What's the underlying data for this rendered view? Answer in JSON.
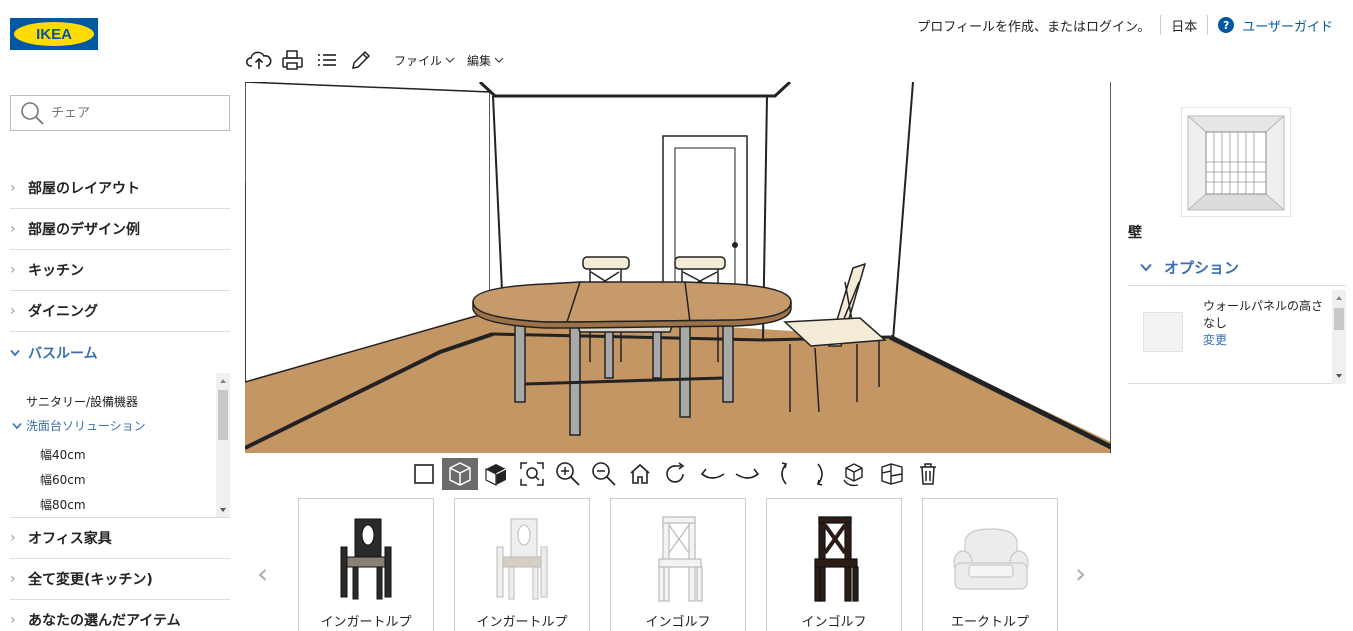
{
  "brand": {
    "logo_text": "IKEA",
    "logo_bg": "#0058a3",
    "logo_fg": "#ffdb00"
  },
  "header": {
    "login_text": "プロフィールを作成、またはログイン。",
    "language": "日本",
    "guide_label": "ユーザーガイド",
    "guide_icon": "?"
  },
  "toolbar": {
    "icons": [
      "cloud-save-icon",
      "print-icon",
      "list-icon",
      "pencil-icon"
    ],
    "file_menu": "ファイル",
    "edit_menu": "編集"
  },
  "sidebar": {
    "search": {
      "value": "",
      "placeholder": "チェア"
    },
    "categories": [
      {
        "label": "部屋のレイアウト"
      },
      {
        "label": "部屋のデザイン例"
      },
      {
        "label": "キッチン"
      },
      {
        "label": "ダイニング"
      },
      {
        "label": "バスルーム",
        "expanded": true
      },
      {
        "label": "オフィス家具"
      },
      {
        "label": "全て変更(キッチン)"
      },
      {
        "label": "あなたの選んだアイテム"
      }
    ],
    "bathroom_sub": {
      "items": [
        {
          "label": "サニタリー/設備機器"
        },
        {
          "label": "洗面台ソリューション",
          "active": true
        }
      ],
      "widths": [
        "幅40cm",
        "幅60cm",
        "幅80cm"
      ]
    }
  },
  "view_tools": [
    "2d-view-icon",
    "3d-view-icon",
    "solid-box-icon",
    "zoom-fit-icon",
    "zoom-in-icon",
    "zoom-out-icon",
    "home-view-icon",
    "rotate-up-icon",
    "rotate-left-icon",
    "rotate-right-icon",
    "turn-left-icon",
    "turn-right-icon",
    "rotate-3d-icon",
    "walls-icon",
    "trash-icon"
  ],
  "products": [
    {
      "name": "インガートルプ",
      "color": "#2a2a2a",
      "seat": "#8a8176",
      "variant": "armchair"
    },
    {
      "name": "インガートルプ",
      "color": "#e6e6e6",
      "seat": "#d6cfc2",
      "variant": "armchair"
    },
    {
      "name": "インゴルフ",
      "color": "#ececec",
      "seat": "#ececec",
      "variant": "x"
    },
    {
      "name": "インゴルフ",
      "color": "#2b1d16",
      "seat": "#2b1d16",
      "variant": "x"
    },
    {
      "name": "エークトルプ",
      "color": "#e7e7e7",
      "seat": "#e7e7e7",
      "variant": "sofa"
    }
  ],
  "right_panel": {
    "section_title": "壁",
    "options_label": "オプション",
    "option": {
      "name": "ウォールパネルの高さ",
      "value": "なし",
      "change_link": "変更"
    }
  },
  "colors": {
    "accent": "#3a6fb0",
    "floor": "#c49664",
    "table": "#c69a6b"
  }
}
